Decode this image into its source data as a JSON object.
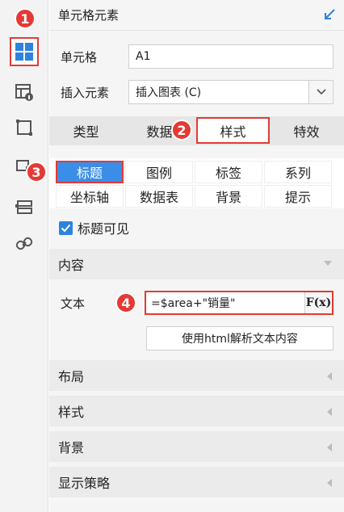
{
  "header": {
    "title": "单元格元素"
  },
  "cell": {
    "label": "单元格",
    "value": "A1"
  },
  "insert": {
    "label": "插入元素",
    "value": "插入图表 (C)"
  },
  "tabs": [
    "类型",
    "数据",
    "样式",
    "特效"
  ],
  "subtabs": [
    "标题",
    "图例",
    "标签",
    "系列",
    "坐标轴",
    "数据表",
    "背景",
    "提示"
  ],
  "checkbox": {
    "label": "标题可见",
    "checked": true
  },
  "content": {
    "section": "内容",
    "text_label": "文本",
    "formula": "=$area+\"销量\"",
    "fx_label": "F(x)",
    "html_button": "使用html解析文本内容"
  },
  "sections": [
    "布局",
    "样式",
    "背景",
    "显示策略"
  ],
  "markers": [
    "1",
    "2",
    "3",
    "4"
  ],
  "colors": {
    "accent_red": "#e53935",
    "tab_blue": "#3b8ee8"
  }
}
